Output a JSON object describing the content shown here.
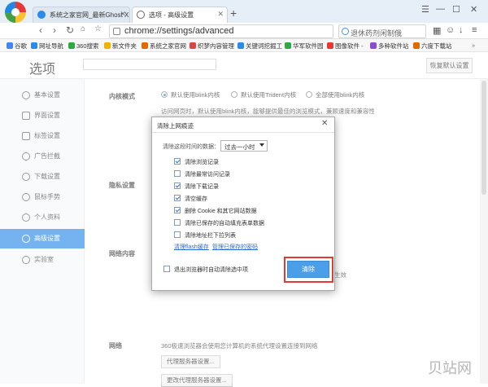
{
  "browser": {
    "tabs": [
      {
        "title": "系统之家官网_最新Ghost X"
      },
      {
        "title": "选项 - 高级设置"
      }
    ],
    "new_tab_symbol": "+",
    "url": "chrome://settings/advanced",
    "search_placeholder": "退休药剂闲制俄",
    "bookmarks": [
      {
        "label": "谷歌",
        "color": "#4285f4"
      },
      {
        "label": "网址导航",
        "color": "#2b8be8"
      },
      {
        "label": "360搜索",
        "color": "#2fa844"
      },
      {
        "label": "新文件夹",
        "color": "#f0b400"
      },
      {
        "label": "系统之家官网",
        "color": "#e06a00"
      },
      {
        "label": "织梦内容管理",
        "color": "#d44"
      },
      {
        "label": "关键词挖掘工",
        "color": "#2b8be8"
      },
      {
        "label": "华军软件园",
        "color": "#2fa844"
      },
      {
        "label": "图像软件 -",
        "color": "#e53935"
      },
      {
        "label": "多种软件站",
        "color": "#8a4bd6"
      },
      {
        "label": "六度下载站",
        "color": "#e06a00"
      }
    ]
  },
  "header": {
    "title": "选项",
    "restore_button": "恢复默认设置"
  },
  "sidebar": {
    "items": [
      {
        "label": "基本设置",
        "icon": "gear-icon"
      },
      {
        "label": "界面设置",
        "icon": "window-icon"
      },
      {
        "label": "标签设置",
        "icon": "tab-icon"
      },
      {
        "label": "广告拦截",
        "icon": "block-icon"
      },
      {
        "label": "下载设置",
        "icon": "download-icon"
      },
      {
        "label": "鼠标手势",
        "icon": "mouse-icon"
      },
      {
        "label": "个人资料",
        "icon": "user-icon"
      },
      {
        "label": "高级设置",
        "icon": "settings-icon",
        "active": true
      },
      {
        "label": "实验室",
        "icon": "lab-icon"
      }
    ]
  },
  "content": {
    "kernel": {
      "heading": "内核模式",
      "options": [
        "默认使用blink内核",
        "默认使用Trident内核",
        "全部使用blink内核"
      ],
      "selected": 0,
      "desc": "访问网页时，默认使用blink内核，能够提供最佳的浏览模式，兼顾速度和兼容性"
    },
    "privacy_heading": "隐私设置",
    "web_content_heading": "网络内容",
    "web_content_partial": "生效",
    "network": {
      "heading": "网络",
      "desc": "360极速浏览器会使用您计算机的系统代理设置连接到网络",
      "proxy_button": "代理服务器设置...",
      "cert_button": "更改代理服务器设置..."
    }
  },
  "dialog": {
    "title": "清除上网痕迹",
    "range_label": "清除这段时间的数据：",
    "range_value": "过去一小时",
    "options": [
      {
        "label": "清除浏览记录",
        "checked": true
      },
      {
        "label": "清除最常访问记录",
        "checked": false
      },
      {
        "label": "清除下载记录",
        "checked": true
      },
      {
        "label": "清空缓存",
        "checked": true
      },
      {
        "label": "删除 Cookie 和其它网站数据",
        "checked": true
      },
      {
        "label": "清除已保存的自动填充表单数据",
        "checked": false
      },
      {
        "label": "清除地址栏下拉列表",
        "checked": false
      }
    ],
    "link_flash": "清理flash缓存",
    "link_passwords": "管理已保存的密码",
    "auto_clear_label": "退出浏览器时自动清除选中项",
    "auto_clear_checked": false,
    "clear_button": "清除"
  },
  "watermark": "贝站网"
}
